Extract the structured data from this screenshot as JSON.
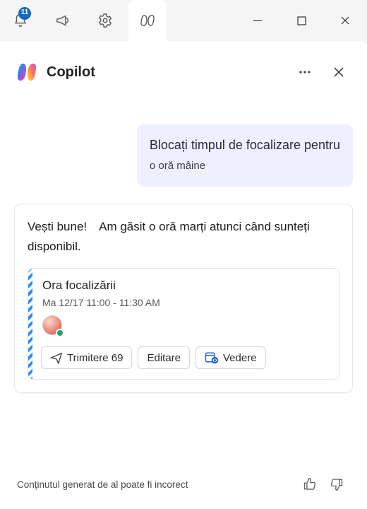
{
  "window": {
    "notification_badge": "11"
  },
  "panel": {
    "title": "Copilot"
  },
  "user_message": {
    "line1": "Blocați timpul de focalizare pentru",
    "line2": "o oră mâine"
  },
  "assistant": {
    "text": "Vești bune! Am găsit o oră marți atunci când sunteți disponibil."
  },
  "event": {
    "title": "Ora focalizării",
    "time": "Ma 12/17 11:00 - 11:30 AM",
    "actions": {
      "send": "Trimitere 69",
      "edit": "Editare",
      "view": "Vedere"
    }
  },
  "footer": {
    "disclaimer": "Conținutul generat de al poate fi incorect"
  },
  "icons": {
    "bell": "bell-icon",
    "megaphone": "megaphone-icon",
    "gear": "gear-icon",
    "copilot": "copilot-icon",
    "minimize": "minimize-icon",
    "maximize": "maximize-icon",
    "close": "close-icon",
    "more": "more-icon",
    "panel_close": "close-icon",
    "send_icon": "send-icon",
    "calendar_view": "calendar-eye-icon",
    "thumbs_up": "thumbs-up-icon",
    "thumbs_down": "thumbs-down-icon"
  }
}
